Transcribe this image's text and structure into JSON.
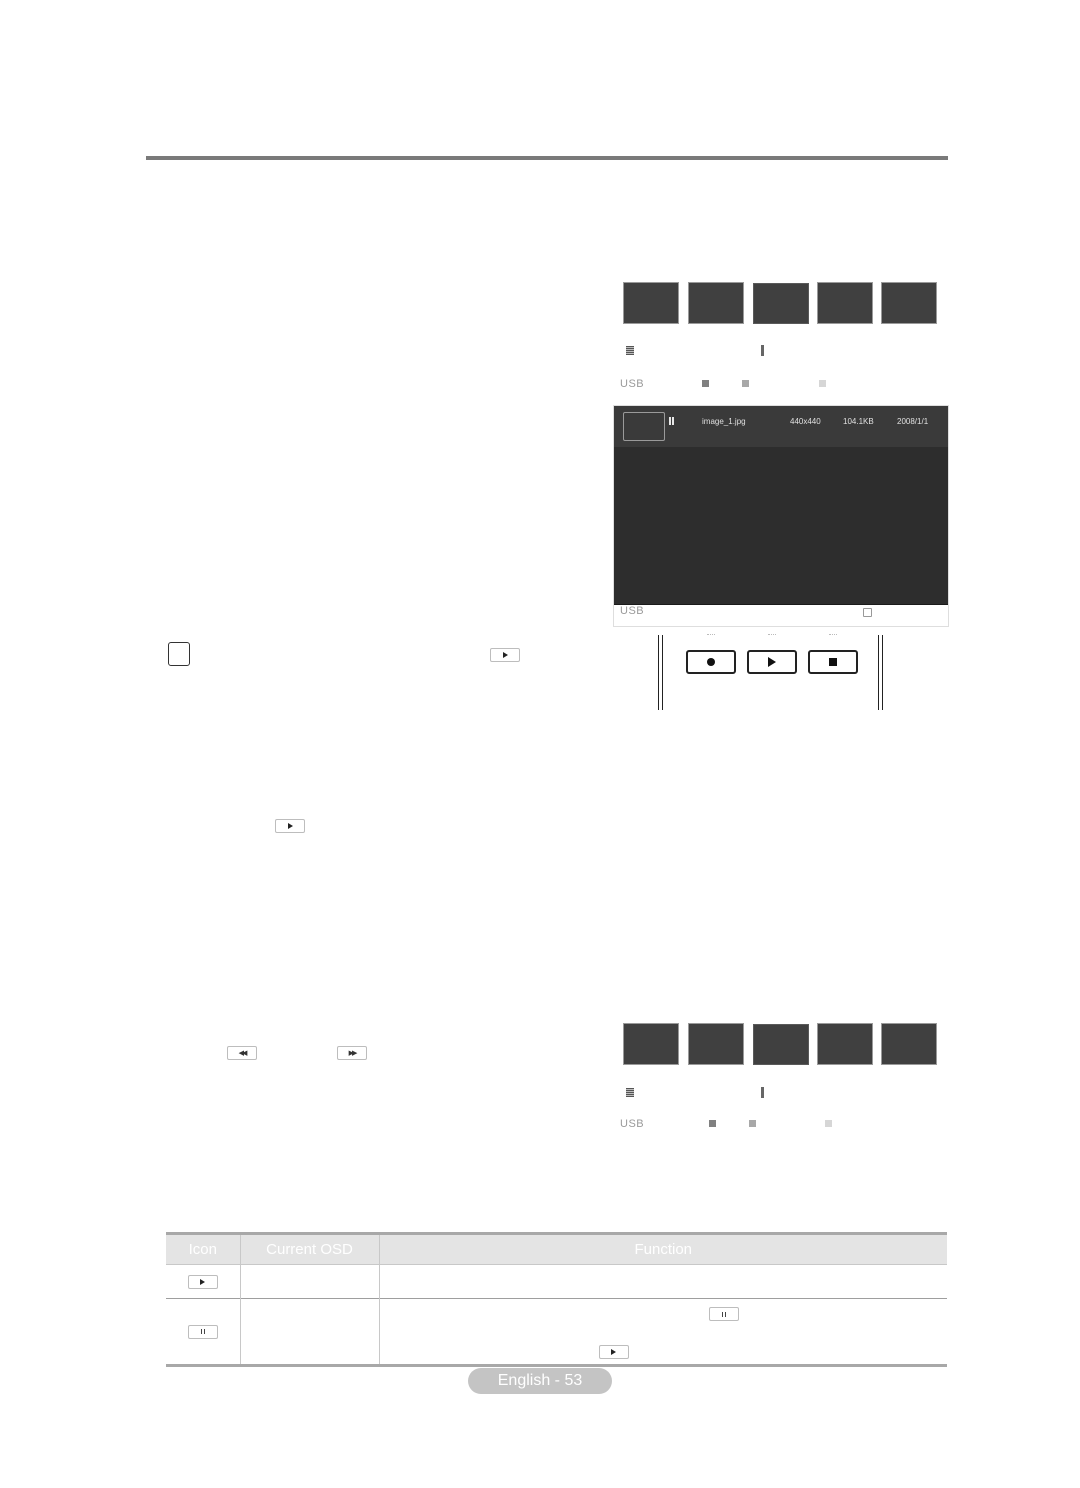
{
  "page": {
    "footer_label": "English - 53"
  },
  "osd_top": {
    "thumbnail_count": 5,
    "selected_index": 2,
    "usb_label": "USB",
    "legend_colors": [
      "#808080",
      "#a8a8a8",
      "#d6d6d6"
    ]
  },
  "viewer": {
    "status_icon": "pause-icon",
    "file_name": "image_1.jpg",
    "resolution": "440x440",
    "file_size": "104.1KB",
    "date": "2008/1/1",
    "footer_usb_label": "USB",
    "footer_icon": "return-icon"
  },
  "remote": {
    "buttons": [
      {
        "name": "record-button",
        "icon": "record-icon"
      },
      {
        "name": "play-button",
        "icon": "play-icon"
      },
      {
        "name": "stop-button",
        "icon": "stop-icon"
      }
    ]
  },
  "inline_keys": {
    "note_key": "play-icon",
    "body_key": "play-icon",
    "rewind_key": "rewind-icon",
    "fast_forward_key": "fast-forward-icon"
  },
  "osd_bottom": {
    "thumbnail_count": 5,
    "selected_index": 2,
    "usb_label": "USB",
    "legend_colors": [
      "#808080",
      "#a8a8a8",
      "#d6d6d6"
    ]
  },
  "table": {
    "headers": [
      "Icon",
      "Current OSD",
      "Function"
    ],
    "rows": [
      {
        "icon": "play-icon",
        "osd": "",
        "function": ""
      },
      {
        "icon": "pause-icon",
        "osd": "",
        "function": "",
        "function_keys": [
          "pause-icon",
          "play-icon"
        ]
      }
    ]
  }
}
